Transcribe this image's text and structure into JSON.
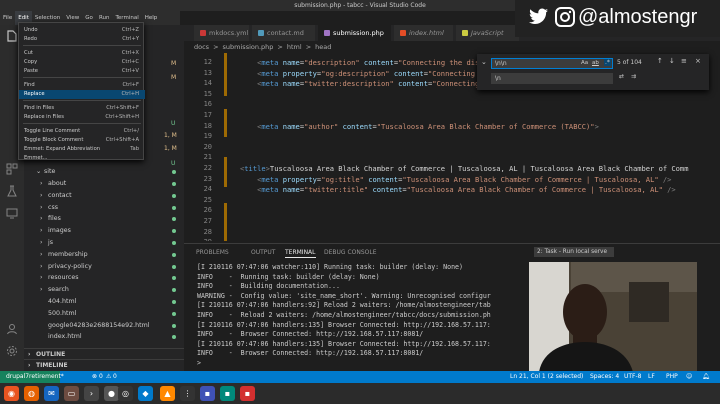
{
  "window": {
    "title": "submission.php - tabcc - Visual Studio Code"
  },
  "menubar": [
    "File",
    "Edit",
    "Selection",
    "View",
    "Go",
    "Run",
    "Terminal",
    "Help"
  ],
  "menubar_active_index": 1,
  "social": {
    "handle": "@almostengr"
  },
  "edit_menu": {
    "items": [
      {
        "label": "Undo",
        "key": "Ctrl+Z"
      },
      {
        "label": "Redo",
        "key": "Ctrl+Y"
      },
      {
        "label": "Cut",
        "key": "Ctrl+X"
      },
      {
        "label": "Copy",
        "key": "Ctrl+C"
      },
      {
        "label": "Paste",
        "key": "Ctrl+V"
      },
      {
        "label": "Find",
        "key": "Ctrl+F"
      },
      {
        "label": "Replace",
        "key": "Ctrl+H"
      },
      {
        "label": "Find in Files",
        "key": "Ctrl+Shift+F"
      },
      {
        "label": "Replace in Files",
        "key": "Ctrl+Shift+H"
      },
      {
        "label": "Toggle Line Comment",
        "key": "Ctrl+/"
      },
      {
        "label": "Toggle Block Comment",
        "key": "Ctrl+Shift+A"
      },
      {
        "label": "Emmet: Expand Abbreviation",
        "key": "Tab"
      },
      {
        "label": "Emmet...",
        "key": ""
      }
    ],
    "highlighted": "Replace"
  },
  "sidebar": {
    "behind_menu": [
      {
        "badge": "M"
      },
      {
        "badge": "M"
      },
      {
        "badge": "U"
      },
      {
        "badge": "1, M"
      },
      {
        "badge": "1, M"
      },
      {
        "badge": "U"
      }
    ],
    "site_folder": "site",
    "files": [
      "about",
      "contact",
      "css",
      "files",
      "images",
      "js",
      "membership",
      "privacy-policy",
      "resources",
      "search",
      "404.html",
      "500.html",
      "google04283e2688154e92.html",
      "index.html"
    ],
    "sections": [
      "OUTLINE",
      "TIMELINE"
    ]
  },
  "tabs": [
    {
      "label": "mkdocs.yml",
      "color": "#cb3837"
    },
    {
      "label": "contact.md",
      "color": "#519aba"
    },
    {
      "label": "submission.php",
      "color": "#a074c4",
      "active": true
    },
    {
      "label": "index.html",
      "color": "#e44d26"
    },
    {
      "label": "JavaScript",
      "color": "#cbcb41"
    }
  ],
  "breadcrumb": {
    "parts": [
      "docs",
      ">",
      "submission.php",
      ">",
      "html",
      ">",
      "head"
    ]
  },
  "editor": {
    "line_numbers": [
      "12",
      "13",
      "14",
      "15",
      "16",
      "17",
      "18",
      "19",
      "20",
      "21",
      "22",
      "23",
      "24",
      "25",
      "26",
      "27",
      "28",
      "29"
    ],
    "lines": [
      {
        "indent": "    ",
        "attr1": "name",
        "val1": "\"description\"",
        "attr2": "content",
        "val2": "\"Connecting the dis"
      },
      {
        "indent": "    ",
        "attr1": "property",
        "val1": "\"og:description\"",
        "attr2": "content",
        "val2": "\"Connecting"
      },
      {
        "indent": "    ",
        "attr1": "name",
        "val1": "\"twitter:description\"",
        "attr2": "content",
        "val2": "\"Connecting"
      },
      null,
      null,
      null,
      {
        "indent": "    ",
        "attr1": "name",
        "val1": "\"author\"",
        "attr2": "content",
        "val2": "\"Tuscaloosa Area Black Chamber of Commerce (TABCC)\"",
        "end": ">"
      },
      null,
      null,
      null,
      {
        "title": true,
        "text": "Tuscaloosa Area Black Chamber of Commerce | Tuscaloosa, AL | Tuscaloosa Area Black Chamber of Comm"
      },
      {
        "indent": "    ",
        "attr1": "property",
        "val1": "\"og:title\"",
        "attr2": "content",
        "val2": "\"Tuscaloosa Area Black Chamber of Commerce | Tuscaloosa, AL\"",
        "end": " />"
      },
      {
        "indent": "    ",
        "attr1": "name",
        "val1": "\"twitter:title\"",
        "attr2": "content",
        "val2": "\"Tuscaloosa Area Black Chamber of Commerce | Tuscaloosa, AL\"",
        "end": " />"
      },
      null,
      null,
      null,
      null,
      null
    ]
  },
  "find_widget": {
    "find_value": "\\n\\n",
    "replace_value": "\\n",
    "count": "5 of 104",
    "aa": "Aa",
    "ab": "ab",
    "regex": ".*"
  },
  "panel": {
    "tabs": [
      "PROBLEMS",
      "OUTPUT",
      "TERMINAL",
      "DEBUG CONSOLE"
    ],
    "active": "TERMINAL",
    "task_select": "2: Task - Run local serve"
  },
  "terminal": {
    "lines": [
      "[I 210116 07:47:06 watcher:110] Running task: builder (delay: None)",
      "INFO    -  Running task: builder (delay: None)",
      "INFO    -  Building documentation...",
      "WARNING -  Config value: 'site_name_short'. Warning: Unrecognised configur",
      "[I 210116 07:47:06 handlers:92] Reload 2 waiters: /home/almostengineer/tab",
      "INFO    -  Reload 2 waiters: /home/almostengineer/tabcc/docs/submission.ph",
      "[I 210116 07:47:06 handlers:135] Browser Connected: http://192.168.57.117:",
      "INFO    -  Browser Connected: http://192.168.57.117:8081/",
      "[I 210116 07:47:06 handlers:135] Browser Connected: http://192.168.57.117:",
      "INFO    -  Browser Connected: http://192.168.57.117:8081/",
      ">"
    ]
  },
  "status": {
    "branch": "drupal7retirement*",
    "errors": "0",
    "warnings": "0",
    "position": "Ln 21, Col 1 (2 selected)",
    "spaces": "Spaces: 4",
    "encoding": "UTF-8",
    "eol": "LF",
    "language": "PHP"
  }
}
